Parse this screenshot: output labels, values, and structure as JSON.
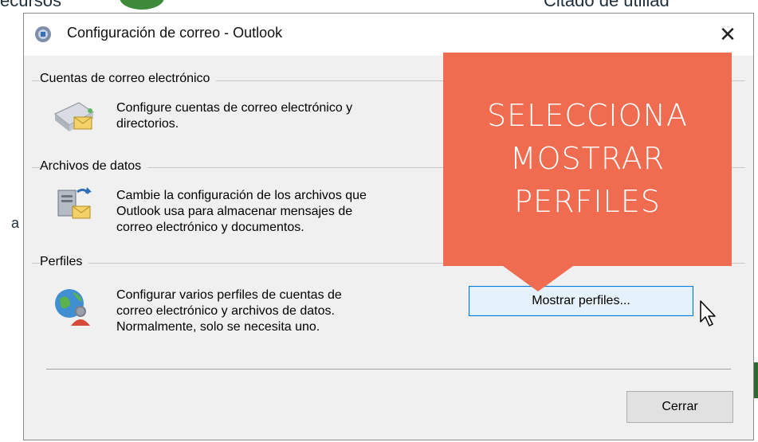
{
  "background": {
    "left_fragment": "ecursos",
    "right_fragment": "Citado de utiliad",
    "left_edge_char": "a"
  },
  "dialog": {
    "title": "Configuración de correo - Outlook",
    "close_glyph": "✕",
    "sections": [
      {
        "label": "Cuentas de correo electrónico",
        "text": "Configure cuentas de correo electrónico y\ndirectorios.",
        "icon": "mail-accounts-icon"
      },
      {
        "label": "Archivos de datos",
        "text": "Cambie la configuración de los archivos que\nOutlook usa para almacenar mensajes de\ncorreo electrónico y documentos.",
        "icon": "data-files-icon"
      },
      {
        "label": "Perfiles",
        "text": "Configurar varios perfiles de cuentas de\ncorreo electrónico y archivos de datos.\nNormalmente, solo se necesita uno.",
        "icon": "profiles-globe-icon"
      }
    ],
    "show_profiles_button": "Mostrar perfiles...",
    "close_button": "Cerrar"
  },
  "callout": {
    "lines": [
      "SELECCIONA",
      "MOSTRAR",
      "PERFILES"
    ],
    "color": "#ef6c50"
  }
}
